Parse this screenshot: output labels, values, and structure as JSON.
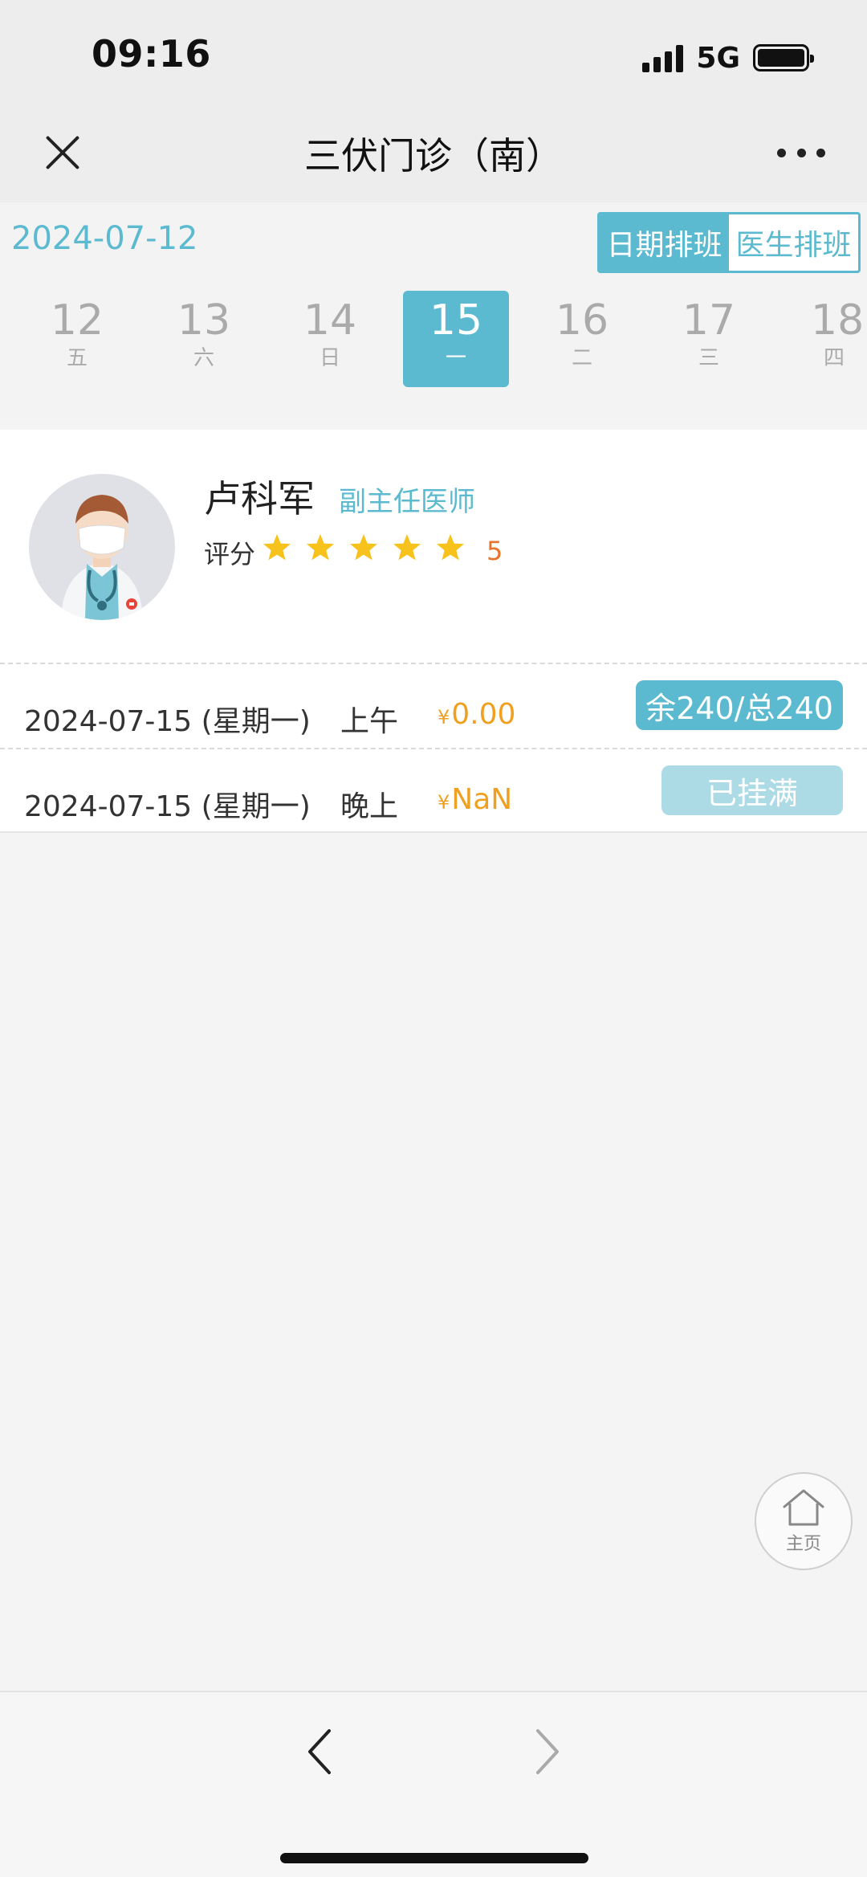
{
  "status_bar": {
    "time": "09:16",
    "network": "5G"
  },
  "header": {
    "title": "三伏门诊（南）"
  },
  "date_bar": {
    "current_date": "2024-07-12",
    "modes": [
      {
        "label": "日期排班",
        "active": true
      },
      {
        "label": "医生排班",
        "active": false
      }
    ],
    "days": [
      {
        "num": "12",
        "weekday": "五",
        "selected": false
      },
      {
        "num": "13",
        "weekday": "六",
        "selected": false
      },
      {
        "num": "14",
        "weekday": "日",
        "selected": false
      },
      {
        "num": "15",
        "weekday": "一",
        "selected": true
      },
      {
        "num": "16",
        "weekday": "二",
        "selected": false
      },
      {
        "num": "17",
        "weekday": "三",
        "selected": false
      },
      {
        "num": "18",
        "weekday": "四",
        "selected": false
      }
    ]
  },
  "doctor": {
    "name": "卢科军",
    "title": "副主任医师",
    "rating_label": "评分",
    "rating_stars": 5,
    "rating_value": "5"
  },
  "schedule": [
    {
      "date": "2024-07-15 (星期一)",
      "period": "上午",
      "currency": "¥",
      "price": "0.00",
      "slot": "余240/总240",
      "status": "available"
    },
    {
      "date": "2024-07-15 (星期一)",
      "period": "晚上",
      "currency": "¥",
      "price": "NaN",
      "slot": "已挂满",
      "status": "full"
    }
  ],
  "home_button": {
    "label": "主页"
  },
  "colors": {
    "accent": "#5bbacf",
    "accent_light": "#acdbe5",
    "price": "#f0a020",
    "rating": "#e8732a",
    "star": "#f8c21c"
  }
}
